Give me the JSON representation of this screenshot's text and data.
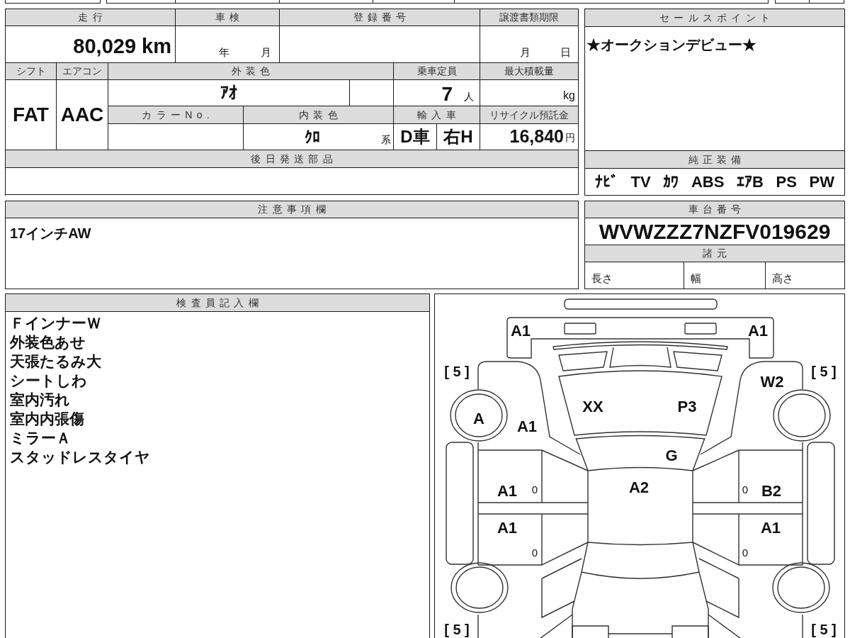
{
  "vehicle_table": {
    "mileage": {
      "label": "走行",
      "value": "80,029 km"
    },
    "inspection": {
      "label": "車検",
      "year_unit": "年",
      "month_unit": "月"
    },
    "registration_number": {
      "label": "登録番号"
    },
    "transfer_deadline": {
      "label": "譲渡書類期限",
      "month_unit": "月",
      "day_unit": "日"
    },
    "shift": {
      "label": "シフト",
      "value": "FAT"
    },
    "air_conditioner": {
      "label": "エアコン",
      "value": "AAC"
    },
    "exterior_color": {
      "label": "外装色",
      "value": "ｱｵ"
    },
    "capacity": {
      "label": "乗車定員",
      "value": "7",
      "unit": "人"
    },
    "max_load": {
      "label": "最大積載量",
      "unit": "kg"
    },
    "color_number": {
      "label": "カラーNo."
    },
    "interior_color": {
      "label": "内装色",
      "value": "ｸﾛ",
      "suffix": "系"
    },
    "imported_car": {
      "label": "輸入車",
      "dealer": "D車",
      "steering": "右H"
    },
    "recycling_deposit": {
      "label": "リサイクル預託金",
      "value": "16,840",
      "unit": "円"
    },
    "parts_sent_later": {
      "label": "後日発送部品"
    }
  },
  "sales_points": {
    "title": "セールスポイント",
    "text": "★オークションデビュー★"
  },
  "standard_equipment": {
    "title": "純正装備",
    "items": [
      "ﾅﾋﾞ",
      "TV",
      "ｶﾜ",
      "ABS",
      "ｴｱB",
      "PS",
      "PW"
    ]
  },
  "notes": {
    "title": "注意事項欄",
    "text": "17インチAW"
  },
  "chassis": {
    "title": "車台番号",
    "number": "WVWZZZ7NZFV019629"
  },
  "specifications": {
    "title": "諸元",
    "fields": [
      "長さ",
      "幅",
      "高さ"
    ]
  },
  "inspector_notes": {
    "title": "検査員記入欄",
    "lines": [
      "ＦインナーＷ",
      "外装色あせ",
      "天張たるみ大",
      "シートしわ",
      "室内汚れ",
      "室内内張傷",
      "ミラーＡ",
      "スタッドレスタイヤ"
    ]
  },
  "damage_diagram": {
    "marks": [
      "A1",
      "A1",
      "[ 5 ]",
      "[ 5 ]",
      "W2",
      "XX",
      "P3",
      "A",
      "A1",
      "G",
      "A1",
      "0",
      "A2",
      "0",
      "B2",
      "A1",
      "A1",
      "0",
      "0",
      "[ 5 ]",
      "[ 5 ]"
    ]
  }
}
